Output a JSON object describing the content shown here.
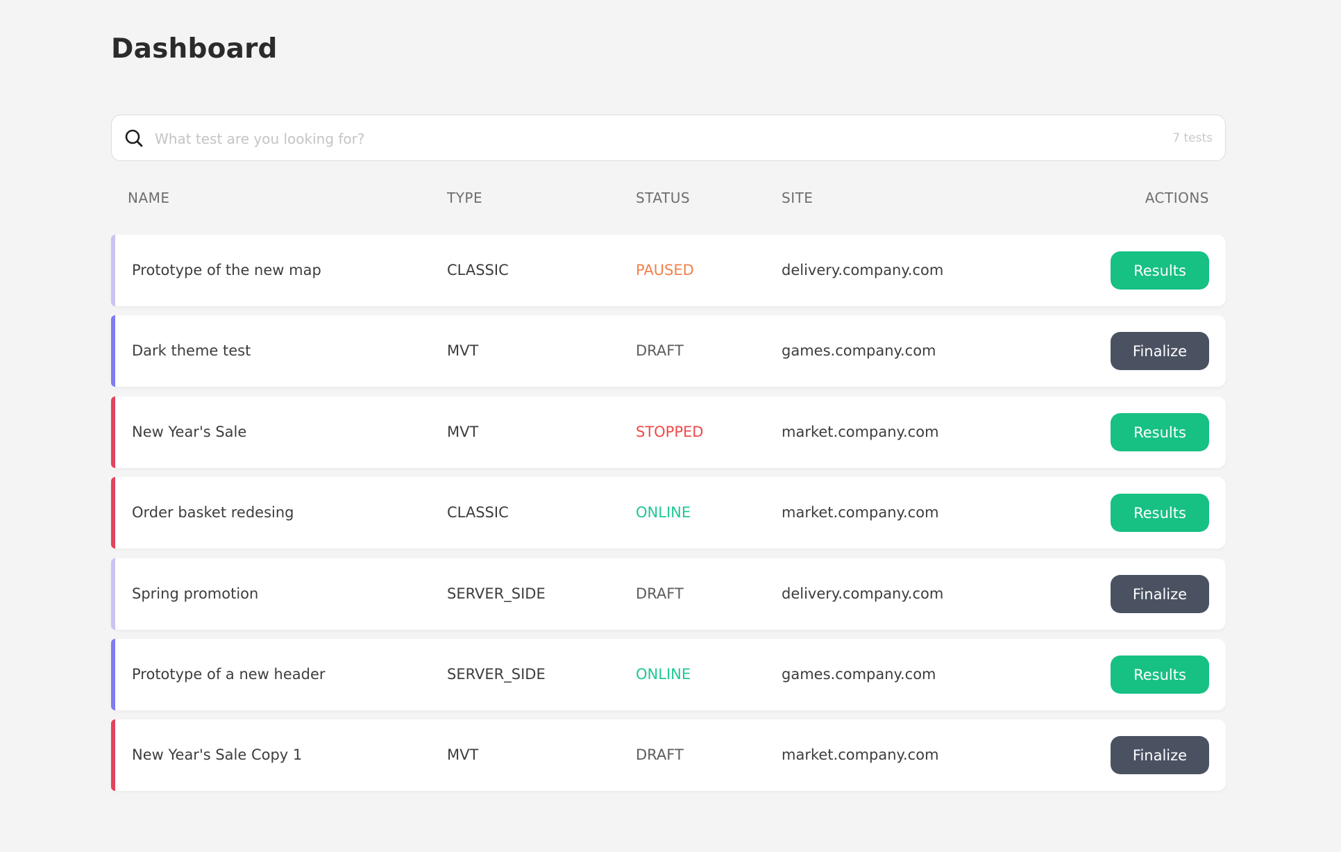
{
  "page_title": "Dashboard",
  "search": {
    "placeholder": "What test are you looking for?",
    "value": "",
    "count_label": "7 tests",
    "icon": "search-icon"
  },
  "table": {
    "columns": [
      "NAME",
      "TYPE",
      "STATUS",
      "SITE",
      "ACTIONS"
    ],
    "rows": [
      {
        "name": "Prototype of the new map",
        "type": "CLASSIC",
        "status": "PAUSED",
        "site": "delivery.company.com",
        "action": "Results",
        "accent": "#c9c4f5"
      },
      {
        "name": "Dark theme test",
        "type": "MVT",
        "status": "DRAFT",
        "site": "games.company.com",
        "action": "Finalize",
        "accent": "#7f7cf1"
      },
      {
        "name": "New Year's Sale",
        "type": "MVT",
        "status": "STOPPED",
        "site": "market.company.com",
        "action": "Results",
        "accent": "#e2445c"
      },
      {
        "name": "Order basket redesing",
        "type": "CLASSIC",
        "status": "ONLINE",
        "site": "market.company.com",
        "action": "Results",
        "accent": "#e2445c"
      },
      {
        "name": "Spring promotion",
        "type": "SERVER_SIDE",
        "status": "DRAFT",
        "site": "delivery.company.com",
        "action": "Finalize",
        "accent": "#c9c4f5"
      },
      {
        "name": "Prototype of a new header",
        "type": "SERVER_SIDE",
        "status": "ONLINE",
        "site": "games.company.com",
        "action": "Results",
        "accent": "#7f7cf1"
      },
      {
        "name": "New Year's Sale Copy 1",
        "type": "MVT",
        "status": "DRAFT",
        "site": "market.company.com",
        "action": "Finalize",
        "accent": "#e2445c"
      }
    ]
  },
  "colors": {
    "status": {
      "PAUSED": "#f2814a",
      "DRAFT": "#5c5c5c",
      "STOPPED": "#ee4a4a",
      "ONLINE": "#1fc795"
    },
    "action": {
      "Results": "#17c083",
      "Finalize": "#4a5262"
    }
  }
}
